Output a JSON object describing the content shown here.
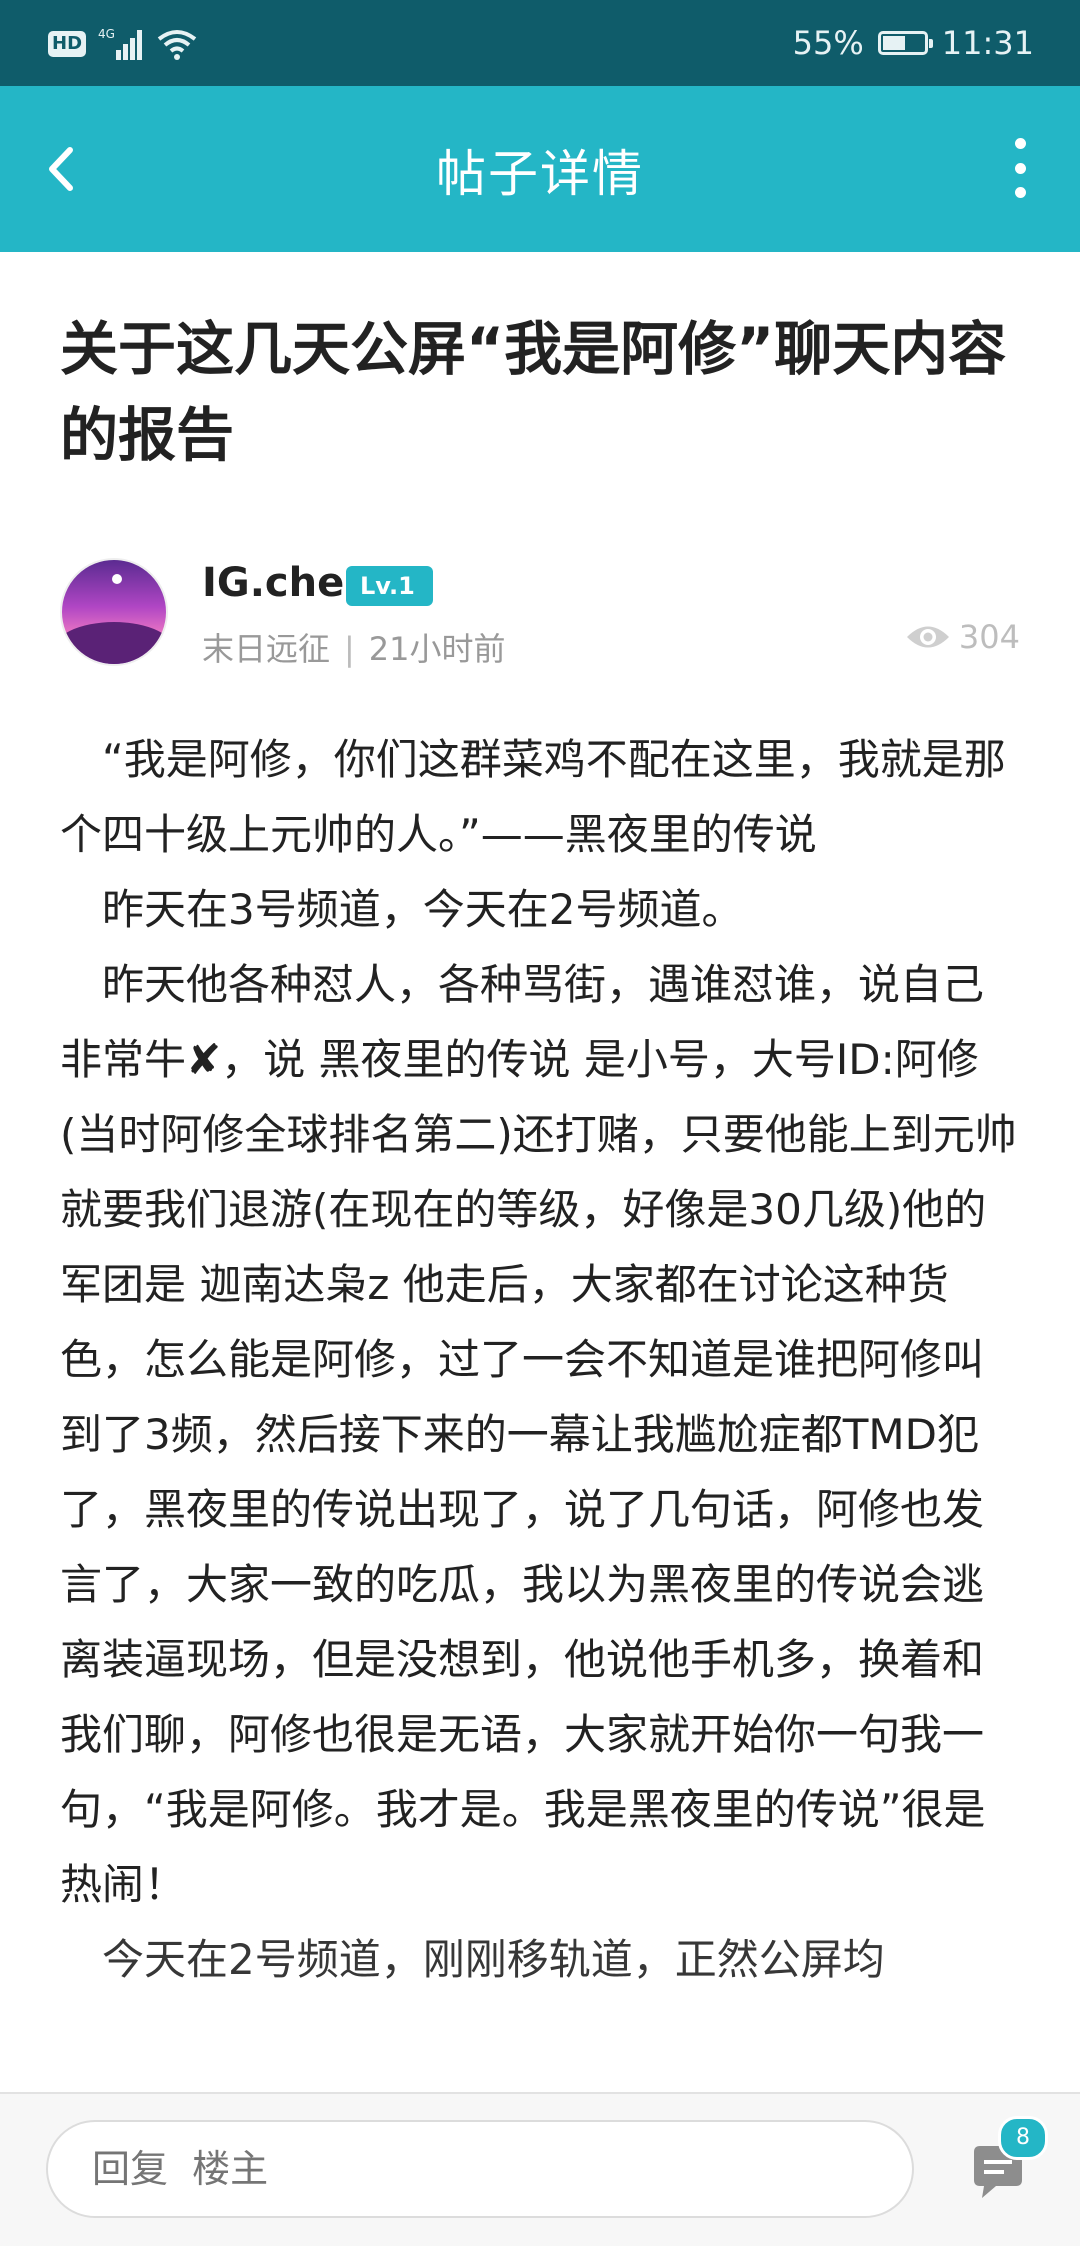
{
  "status_bar": {
    "hd": "HD",
    "network": "4G",
    "battery": "55%",
    "battery_level": 0.55,
    "time": "11:31"
  },
  "header": {
    "title": "帖子详情",
    "back_icon": "chevron-left-icon",
    "more_icon": "more-vertical-icon"
  },
  "post": {
    "title": "关于这几天公屏“我是阿修”聊天内容的报告",
    "author": {
      "name": "IG.che",
      "level": "Lv.1",
      "guild": "末日远征",
      "separator": "|",
      "time": "21小时前"
    },
    "views": "304",
    "paragraphs": [
      "“我是阿修，你们这群菜鸡不配在这里，我就是那个四十级上元帅的人。”——黑夜里的传说",
      "昨天在3号频道，今天在2号频道。",
      "昨天他各种怼人，各种骂街，遇谁怼谁，说自己非常牛✘，说 黑夜里的传说 是小号，大号ID:阿修(当时阿修全球排名第二)还打赌，只要他能上到元帅就要我们退游(在现在的等级，好像是30几级)他的军团是  迦南达枭z 他走后，大家都在讨论这种货色，怎么能是阿修，过了一会不知道是谁把阿修叫到了3频，然后接下来的一幕让我尴尬症都TMD犯了，黑夜里的传说出现了，说了几句话，阿修也发言了，大家一致的吃瓜，我以为黑夜里的传说会逃离装逼现场，但是没想到，他说他手机多，换着和我们聊，阿修也很是无语，大家就开始你一句我一句，“我是阿修。我才是。我是黑夜里的传说”很是热闹！",
      "今天在2号频道，刚刚移轨道，正然公屏均"
    ]
  },
  "bottom_bar": {
    "reply_placeholder": "回复  楼主",
    "comment_count": "8"
  },
  "colors": {
    "status_bar": "#0f5c6a",
    "accent": "#24b6c6",
    "text": "#222222",
    "muted": "#999999"
  }
}
